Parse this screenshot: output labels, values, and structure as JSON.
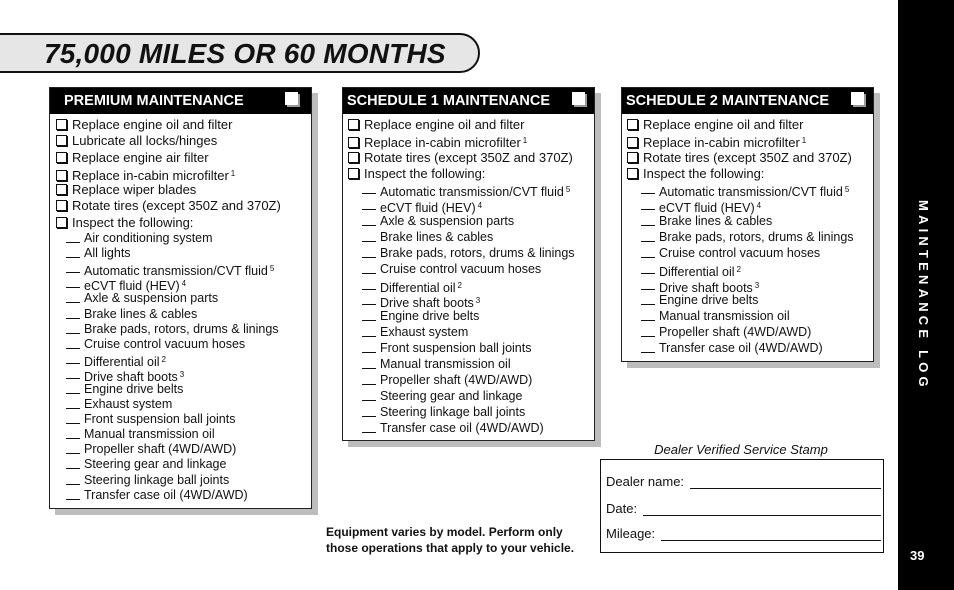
{
  "title": "75,000 MILES OR 60 MONTHS",
  "premium": {
    "header": "PREMIUM MAINTENANCE",
    "items": [
      {
        "text": "Replace engine oil and filter",
        "sup": ""
      },
      {
        "text": "Lubricate all locks/hinges",
        "sup": ""
      },
      {
        "text": "Replace engine air filter",
        "sup": ""
      },
      {
        "text": "Replace in-cabin microfilter",
        "sup": "1"
      },
      {
        "text": "Replace wiper blades",
        "sup": ""
      },
      {
        "text": "Rotate tires (except 350Z and 370Z)",
        "sup": ""
      },
      {
        "text": "Inspect the following:",
        "sup": ""
      }
    ],
    "inspect": [
      {
        "text": "Air conditioning system",
        "sup": ""
      },
      {
        "text": "All lights",
        "sup": ""
      },
      {
        "text": "Automatic transmission/CVT fluid",
        "sup": "5"
      },
      {
        "text": "eCVT fluid (HEV)",
        "sup": "4"
      },
      {
        "text": "Axle & suspension parts",
        "sup": ""
      },
      {
        "text": "Brake lines & cables",
        "sup": ""
      },
      {
        "text": "Brake pads, rotors, drums & linings",
        "sup": ""
      },
      {
        "text": "Cruise control vacuum hoses",
        "sup": ""
      },
      {
        "text": "Differential oil",
        "sup": "2"
      },
      {
        "text": "Drive shaft boots",
        "sup": "3"
      },
      {
        "text": "Engine drive belts",
        "sup": ""
      },
      {
        "text": "Exhaust system",
        "sup": ""
      },
      {
        "text": "Front suspension ball joints",
        "sup": ""
      },
      {
        "text": "Manual transmission oil",
        "sup": ""
      },
      {
        "text": "Propeller shaft (4WD/AWD)",
        "sup": ""
      },
      {
        "text": "Steering gear and linkage",
        "sup": ""
      },
      {
        "text": "Steering linkage ball joints",
        "sup": ""
      },
      {
        "text": "Transfer case oil (4WD/AWD)",
        "sup": ""
      }
    ]
  },
  "schedule1": {
    "header": "SCHEDULE 1 MAINTENANCE",
    "items": [
      {
        "text": "Replace engine oil and filter",
        "sup": ""
      },
      {
        "text": "Replace in-cabin microfilter",
        "sup": "1"
      },
      {
        "text": "Rotate tires (except 350Z and 370Z)",
        "sup": ""
      },
      {
        "text": "Inspect the following:",
        "sup": ""
      }
    ],
    "inspect": [
      {
        "text": "Automatic transmission/CVT fluid",
        "sup": "5"
      },
      {
        "text": "eCVT fluid (HEV)",
        "sup": "4"
      },
      {
        "text": "Axle & suspension parts",
        "sup": ""
      },
      {
        "text": "Brake lines & cables",
        "sup": ""
      },
      {
        "text": "Brake pads, rotors, drums & linings",
        "sup": ""
      },
      {
        "text": "Cruise control vacuum hoses",
        "sup": ""
      },
      {
        "text": "Differential oil",
        "sup": "2"
      },
      {
        "text": "Drive shaft boots",
        "sup": "3"
      },
      {
        "text": "Engine drive belts",
        "sup": ""
      },
      {
        "text": "Exhaust system",
        "sup": ""
      },
      {
        "text": "Front suspension ball joints",
        "sup": ""
      },
      {
        "text": "Manual transmission oil",
        "sup": ""
      },
      {
        "text": "Propeller shaft (4WD/AWD)",
        "sup": ""
      },
      {
        "text": "Steering gear and linkage",
        "sup": ""
      },
      {
        "text": "Steering linkage ball joints",
        "sup": ""
      },
      {
        "text": "Transfer case oil (4WD/AWD)",
        "sup": ""
      }
    ]
  },
  "schedule2": {
    "header": "SCHEDULE 2 MAINTENANCE",
    "items": [
      {
        "text": "Replace engine oil and filter",
        "sup": ""
      },
      {
        "text": "Replace in-cabin microfilter",
        "sup": "1"
      },
      {
        "text": "Rotate tires (except 350Z and 370Z)",
        "sup": ""
      },
      {
        "text": "Inspect the following:",
        "sup": ""
      }
    ],
    "inspect": [
      {
        "text": "Automatic transmission/CVT fluid",
        "sup": "5"
      },
      {
        "text": "eCVT fluid (HEV)",
        "sup": "4"
      },
      {
        "text": "Brake lines & cables",
        "sup": ""
      },
      {
        "text": "Brake pads, rotors, drums & linings",
        "sup": ""
      },
      {
        "text": "Cruise control vacuum hoses",
        "sup": ""
      },
      {
        "text": "Differential oil",
        "sup": "2"
      },
      {
        "text": "Drive shaft boots",
        "sup": "3"
      },
      {
        "text": "Engine drive belts",
        "sup": ""
      },
      {
        "text": "Manual transmission oil",
        "sup": ""
      },
      {
        "text": "Propeller shaft (4WD/AWD)",
        "sup": ""
      },
      {
        "text": "Transfer case oil (4WD/AWD)",
        "sup": ""
      }
    ]
  },
  "stamp": {
    "caption": "Dealer Verified Service Stamp",
    "dealer_label": "Dealer name:",
    "date_label": "Date:",
    "mileage_label": "Mileage:"
  },
  "note": {
    "line1": "Equipment varies by model. Perform only",
    "line2": "those operations that apply to your vehicle."
  },
  "sidebar": {
    "label": "MAINTENANCE LOG",
    "page_number": "39"
  }
}
